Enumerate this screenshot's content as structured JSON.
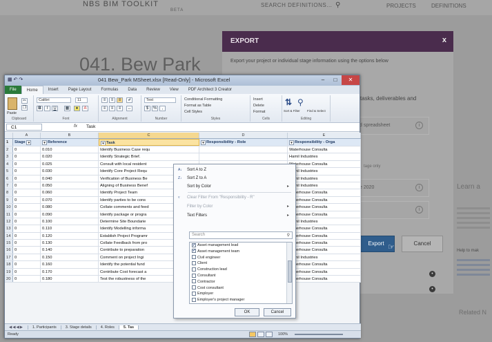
{
  "site": {
    "brand": "NBS BIM TOOLKIT",
    "beta": "BETA",
    "search_label": "SEARCH DEFINITIONS...",
    "nav_projects": "PROJECTS",
    "nav_definitions": "DEFINITIONS",
    "page_title": "041. Bew Park",
    "learn": "Learn a",
    "help": "Help to mak",
    "related": "Related N"
  },
  "modal": {
    "title": "EXPORT",
    "close": "x",
    "intro": "Export your project or individual stage information using the options below",
    "partial_tasks": "tasks, deliverables and",
    "row_spreadsheet": "d spreadsheet",
    "stage_only": "tage only",
    "row_2": "e 2020",
    "row_3": "",
    "export_label": "Export",
    "cancel_label": "Cancel",
    "side_items": [
      "ject",
      "o",
      "ogs)"
    ]
  },
  "excel": {
    "title": "041 Bew_Park MSheet.xlsx  [Read-Only]  -  Microsoft Excel",
    "tabs": [
      "File",
      "Home",
      "Insert",
      "Page Layout",
      "Formulas",
      "Data",
      "Review",
      "View",
      "PDF Architect 3 Creator"
    ],
    "ribbon": {
      "clipboard": "Clipboard",
      "font": "Font",
      "font_name": "Calibri",
      "font_size": "11",
      "alignment": "Alignment",
      "number": "Number",
      "number_format": "Text",
      "styles": "Styles",
      "cond_format": "Conditional Formatting",
      "format_table": "Format as Table",
      "cell_styles": "Cell Styles",
      "cells": "Cells",
      "insert": "Insert",
      "delete": "Delete",
      "format": "Format",
      "editing": "Editing",
      "sort_filter": "Sort & Filter",
      "find_select": "Find & Select",
      "paste": "Paste"
    },
    "name_box": "C1",
    "formula_value": "Task",
    "columns": [
      "A",
      "B",
      "C",
      "D",
      "E"
    ],
    "headers": [
      "Stage",
      "Reference",
      "Task",
      "Responsibility - Role",
      "Responsibility - Orga"
    ],
    "rows": [
      {
        "n": "2",
        "a": "0",
        "b": "0.010",
        "c": "Identify Business Case requ",
        "e": "Waterhouse Consulta"
      },
      {
        "n": "3",
        "a": "0",
        "b": "0.020",
        "c": "Identify Strategic Brief.",
        "e": "Hamil Industries"
      },
      {
        "n": "4",
        "a": "0",
        "b": "0.025",
        "c": "Consult with local resident",
        "e": "Waterhouse Consulta"
      },
      {
        "n": "5",
        "a": "0",
        "b": "0.030",
        "c": "Identify Core Project Requ",
        "e": "Hamil Industries"
      },
      {
        "n": "6",
        "a": "0",
        "b": "0.040",
        "c": "Verification of Business Be",
        "e": "Hamil Industries"
      },
      {
        "n": "7",
        "a": "0",
        "b": "0.050",
        "c": "Aligning of Business Benef",
        "e": "Hamil Industries"
      },
      {
        "n": "8",
        "a": "0",
        "b": "0.060",
        "c": "Identify Project Team",
        "e": "Waterhouse Consulta"
      },
      {
        "n": "9",
        "a": "0",
        "b": "0.070",
        "c": "Identify parties to be cons",
        "e": "Waterhouse Consulta"
      },
      {
        "n": "10",
        "a": "0",
        "b": "0.080",
        "c": "Collate comments and feed",
        "e": "Waterhouse Consulta"
      },
      {
        "n": "11",
        "a": "0",
        "b": "0.090",
        "c": "Identify package or progra",
        "e": "Waterhouse Consulta"
      },
      {
        "n": "12",
        "a": "0",
        "b": "0.100",
        "c": "Determine Site Boundarie",
        "e": "Hamil Industries"
      },
      {
        "n": "13",
        "a": "0",
        "b": "0.110",
        "c": "Identify Modelling informa",
        "e": "Waterhouse Consulta"
      },
      {
        "n": "14",
        "a": "0",
        "b": "0.120",
        "c": "Establish Project Programr",
        "e": "Waterhouse Consulta"
      },
      {
        "n": "15",
        "a": "0",
        "b": "0.130",
        "c": "Collate Feedback from pro",
        "e": "Waterhouse Consulta"
      },
      {
        "n": "16",
        "a": "0",
        "b": "0.140",
        "c": "Contribute to preparation",
        "e": "Waterhouse Consulta"
      },
      {
        "n": "17",
        "a": "0",
        "b": "0.150",
        "c": "Comment on project Ingi",
        "e": "Hamil Industries"
      },
      {
        "n": "18",
        "a": "0",
        "b": "0.160",
        "c": "Identify the potential fund",
        "e": "Waterhouse Consulta"
      },
      {
        "n": "19",
        "a": "0",
        "b": "0.170",
        "c": "Contribute Cost forecast a",
        "e": "Waterhouse Consulta"
      },
      {
        "n": "20",
        "a": "0",
        "b": "0.180",
        "c": "Test the robustness of the",
        "e": "Waterhouse Consulta"
      }
    ],
    "sheet_tabs": [
      "1. Participants",
      "3. Stage details",
      "4. Roles",
      "5. Tas"
    ],
    "status": "Ready",
    "zoom": "100%"
  },
  "filter": {
    "sort_az": "Sort A to Z",
    "sort_za": "Sort Z to A",
    "sort_color": "Sort by Color",
    "clear_filter": "Clear Filter From \"Responsibility - R\"",
    "filter_color": "Filter by Color",
    "text_filters": "Text Filters",
    "search_placeholder": "Search",
    "options": [
      {
        "label": "Asset management lead",
        "checked": true
      },
      {
        "label": "Asset management team",
        "checked": true
      },
      {
        "label": "Civil engineer",
        "checked": false
      },
      {
        "label": "Client",
        "checked": false
      },
      {
        "label": "Construction lead",
        "checked": false
      },
      {
        "label": "Consultant",
        "checked": false
      },
      {
        "label": "Contractor",
        "checked": false
      },
      {
        "label": "Cost consultant",
        "checked": false
      },
      {
        "label": "Employer",
        "checked": false
      },
      {
        "label": "Employer's project manager",
        "checked": false
      }
    ],
    "ok": "OK",
    "cancel": "Cancel"
  }
}
